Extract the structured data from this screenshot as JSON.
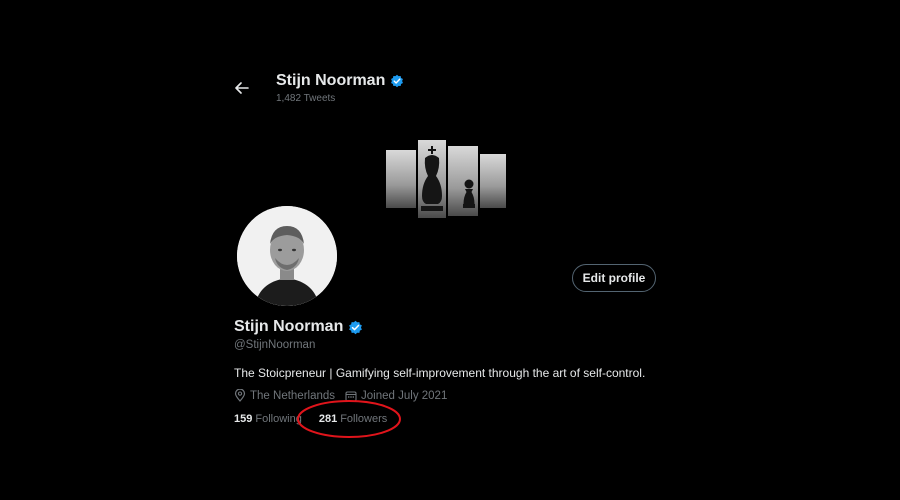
{
  "header": {
    "name": "Stijn Noorman",
    "tweet_count": "1,482 Tweets"
  },
  "profile": {
    "name": "Stijn Noorman",
    "handle": "@StijnNoorman",
    "bio": "The Stoicpreneur | Gamifying self-improvement through the art of self-control.",
    "location": "The Netherlands",
    "joined": "Joined July 2021",
    "following_count": "159",
    "following_label": "Following",
    "followers_count": "281",
    "followers_label": "Followers",
    "edit_label": "Edit profile"
  },
  "colors": {
    "background": "#000000",
    "verified": "#1d9bf0",
    "muted_text": "#71767b",
    "annotation": "#e0141b"
  },
  "icons": [
    "back-arrow-icon",
    "verified-badge-icon",
    "location-pin-icon",
    "calendar-icon"
  ]
}
